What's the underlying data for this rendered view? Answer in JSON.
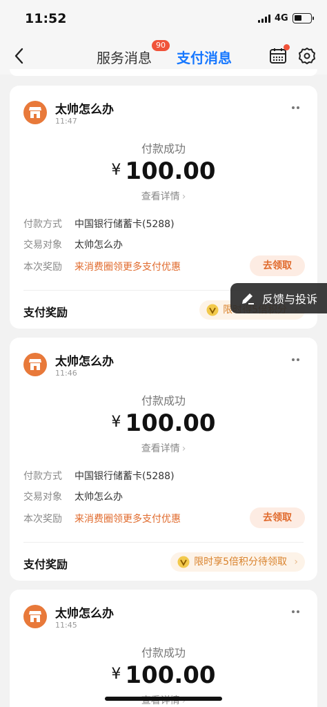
{
  "status_bar": {
    "time": "11:52",
    "network": "4G"
  },
  "nav": {
    "tabs": [
      {
        "label": "服务消息",
        "badge": "90"
      },
      {
        "label": "支付消息"
      }
    ],
    "active_tab": "支付消息"
  },
  "cards": [
    {
      "merchant": "太帅怎么办",
      "time": "11:47",
      "status": "付款成功",
      "currency": "¥",
      "amount": "100.00",
      "detail_link": "查看详情",
      "rows": [
        {
          "key": "付款方式",
          "value": "中国银行储蓄卡(5288)"
        },
        {
          "key": "交易对象",
          "value": "太帅怎么办"
        },
        {
          "key": "本次奖励",
          "value": "来消费圈领更多支付优惠"
        }
      ],
      "claim_button": "去领取",
      "reward_title": "支付奖励",
      "reward_pill": "限时得5倍积分"
    },
    {
      "merchant": "太帅怎么办",
      "time": "11:46",
      "status": "付款成功",
      "currency": "¥",
      "amount": "100.00",
      "detail_link": "查看详情",
      "rows": [
        {
          "key": "付款方式",
          "value": "中国银行储蓄卡(5288)"
        },
        {
          "key": "交易对象",
          "value": "太帅怎么办"
        },
        {
          "key": "本次奖励",
          "value": "来消费圈领更多支付优惠"
        }
      ],
      "claim_button": "去领取",
      "reward_title": "支付奖励",
      "reward_pill": "限时享5倍积分待领取"
    },
    {
      "merchant": "太帅怎么办",
      "time": "11:45",
      "status": "付款成功",
      "currency": "¥",
      "amount": "100.00",
      "detail_link": "查看详情"
    }
  ],
  "floating": {
    "label": "反馈与投诉"
  },
  "colors": {
    "accent": "#1677ff",
    "orange": "#e06a2c",
    "badge": "#f0533a"
  }
}
